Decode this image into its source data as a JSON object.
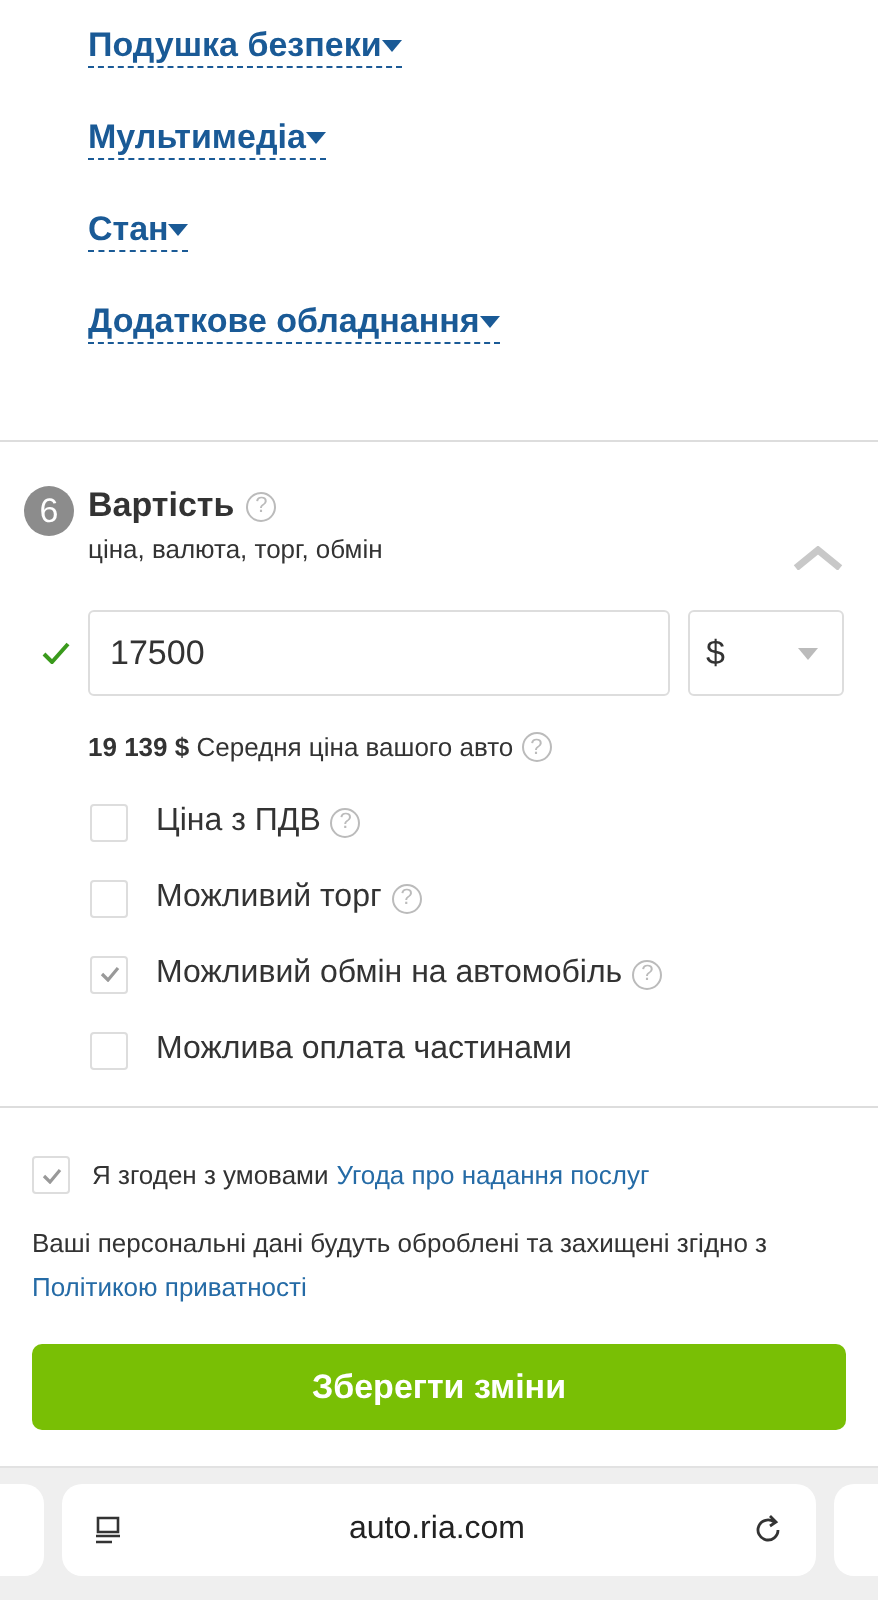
{
  "filters": [
    {
      "label": "Подушка безпеки"
    },
    {
      "label": "Мультимедіа"
    },
    {
      "label": "Стан"
    },
    {
      "label": "Додаткове обладнання"
    }
  ],
  "section": {
    "number": "6",
    "title": "Вартість",
    "title_help": "?",
    "subtitle": "ціна, валюта, торг, обмін",
    "price": {
      "value": "17500"
    },
    "currency": {
      "value": "$"
    },
    "average_price": "**19 139 $** Середня ціна вашого авто",
    "average_help": "?",
    "options": [
      {
        "label": "Ціна з ПДВ",
        "checked": false,
        "help": "?"
      },
      {
        "label": "Можливий торг",
        "checked": false,
        "help": "?"
      },
      {
        "label": "Можливий обмін на автомобіль",
        "checked": true,
        "help": "?"
      },
      {
        "label": "Можлива оплата частинами",
        "checked": false
      }
    ]
  },
  "agreement": {
    "checked": true,
    "text": "Я згоден з умовами",
    "link": "Угода про надання послуг"
  },
  "privacy": {
    "text": "Ваші персональні дані будуть оброблені та захищені згідно з",
    "link": "Політикою приватності"
  },
  "save_button": "Зберегти зміни",
  "browser": {
    "url": "auto.ria.com"
  }
}
